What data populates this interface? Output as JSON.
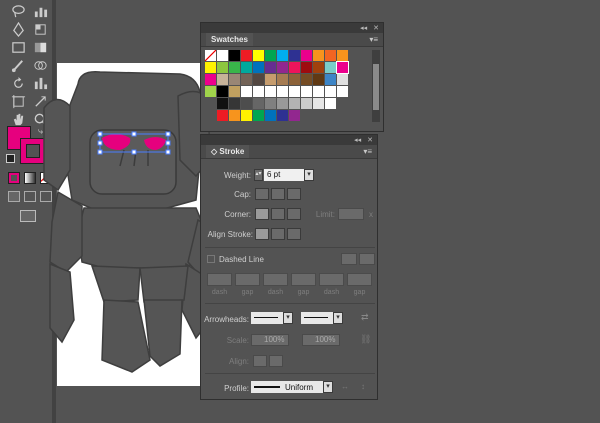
{
  "colors": {
    "fill": "#e6007e",
    "stroke": "#e6007e",
    "ui_bg": "#535353"
  },
  "swatches_panel": {
    "title": "Swatches",
    "rows": [
      [
        "#ffffff",
        "#ffffff",
        "#000000",
        "#ed1c24",
        "#ffff00",
        "#00a651",
        "#00aeef",
        "#2e3192",
        "#ec008c",
        "#f7941d",
        "#f26522",
        "#f7941d"
      ],
      [
        "#fff200",
        "#8dc63f",
        "#39b54a",
        "#00a99d",
        "#0072bc",
        "#662d91",
        "#92278f",
        "#ed145b",
        "#9e0b0f",
        "#a0410d",
        "#7accc8",
        "#ec008c"
      ],
      [
        "#ec008c",
        "#c7b299",
        "#998675",
        "#736357",
        "#534741",
        "#c69c6d",
        "#a67c52",
        "#8c6239",
        "#754c24",
        "#603913",
        "#3d85c6",
        "#e0e0e0"
      ],
      [
        "#a0d44b",
        "#000000",
        "#c0a060",
        "#ffffff",
        "#ffffff",
        "#ffffff",
        "#ffffff",
        "#ffffff",
        "#ffffff",
        "#ffffff",
        "#ffffff",
        "#ffffff"
      ],
      [
        "#535353",
        "#111111",
        "#363636",
        "#4d4d4d",
        "#666666",
        "#808080",
        "#999999",
        "#b3b3b3",
        "#cccccc",
        "#e6e6e6",
        "#ffffff",
        "#535353"
      ],
      [
        "#535353",
        "#ed1c24",
        "#f7941d",
        "#fff200",
        "#00a651",
        "#0072bc",
        "#2e3192",
        "#92278f",
        "#535353",
        "#535353",
        "#535353",
        "#535353"
      ]
    ]
  },
  "stroke_panel": {
    "title": "Stroke",
    "weight_label": "Weight:",
    "weight_value": "6 pt",
    "cap_label": "Cap:",
    "corner_label": "Corner:",
    "limit_label": "Limit:",
    "limit_suffix": "x",
    "align_label": "Align Stroke:",
    "dashed_label": "Dashed Line",
    "dash_labels": [
      "dash",
      "gap",
      "dash",
      "gap",
      "dash",
      "gap"
    ],
    "arrowheads_label": "Arrowheads:",
    "scale_label": "Scale:",
    "scale_1": "100%",
    "scale_2": "100%",
    "align_arrow_label": "Align:",
    "profile_label": "Profile:",
    "profile_value": "Uniform"
  }
}
